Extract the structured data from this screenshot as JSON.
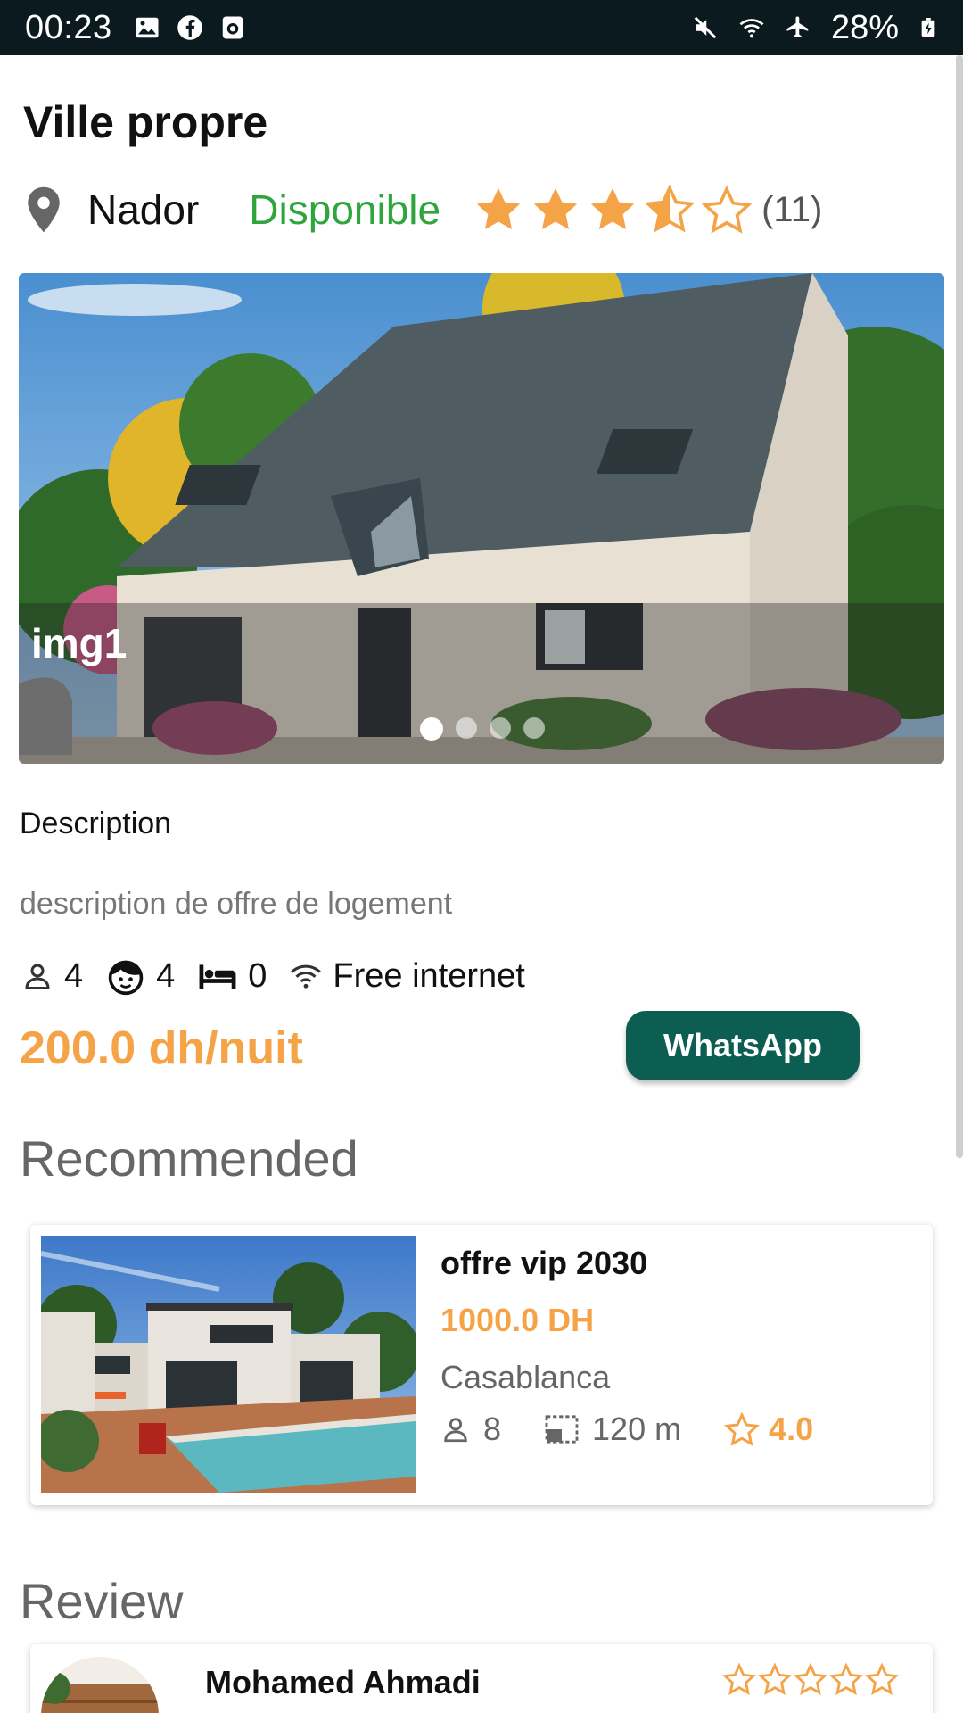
{
  "status_bar": {
    "time": "00:23",
    "battery": "28%",
    "left_icons": [
      "gallery-icon",
      "facebook-icon",
      "camera-notify-icon"
    ],
    "right_icons": [
      "mute-icon",
      "wifi-icon",
      "airplane-icon",
      "battery-charging-icon"
    ]
  },
  "listing": {
    "title": "Ville propre",
    "city": "Nador",
    "availability": "Disponible",
    "rating": 3.5,
    "rating_count": "(11)",
    "image_caption": "img1",
    "image_count": 4,
    "active_image": 1,
    "description_label": "Description",
    "description": "description de  offre de logement",
    "amenities": {
      "adults": "4",
      "children": "4",
      "beds": "0",
      "internet": "Free internet"
    },
    "price": "200.0 dh/nuit",
    "whatsapp_label": "WhatsApp"
  },
  "recommended": {
    "section_title": "Recommended",
    "items": [
      {
        "name": "offre vip 2030",
        "price": "1000.0 DH",
        "city": "Casablanca",
        "guests": "8",
        "area": "120 m",
        "rating": "4.0"
      }
    ]
  },
  "reviews": {
    "section_title": "Review",
    "items": [
      {
        "name": "Mohamed Ahmadi",
        "stars": 0
      }
    ]
  },
  "colors": {
    "accent_orange": "#f4a347",
    "available_green": "#2ea63c",
    "whatsapp_green": "#0c5e53",
    "status_bar_bg": "#0b1a1f"
  }
}
